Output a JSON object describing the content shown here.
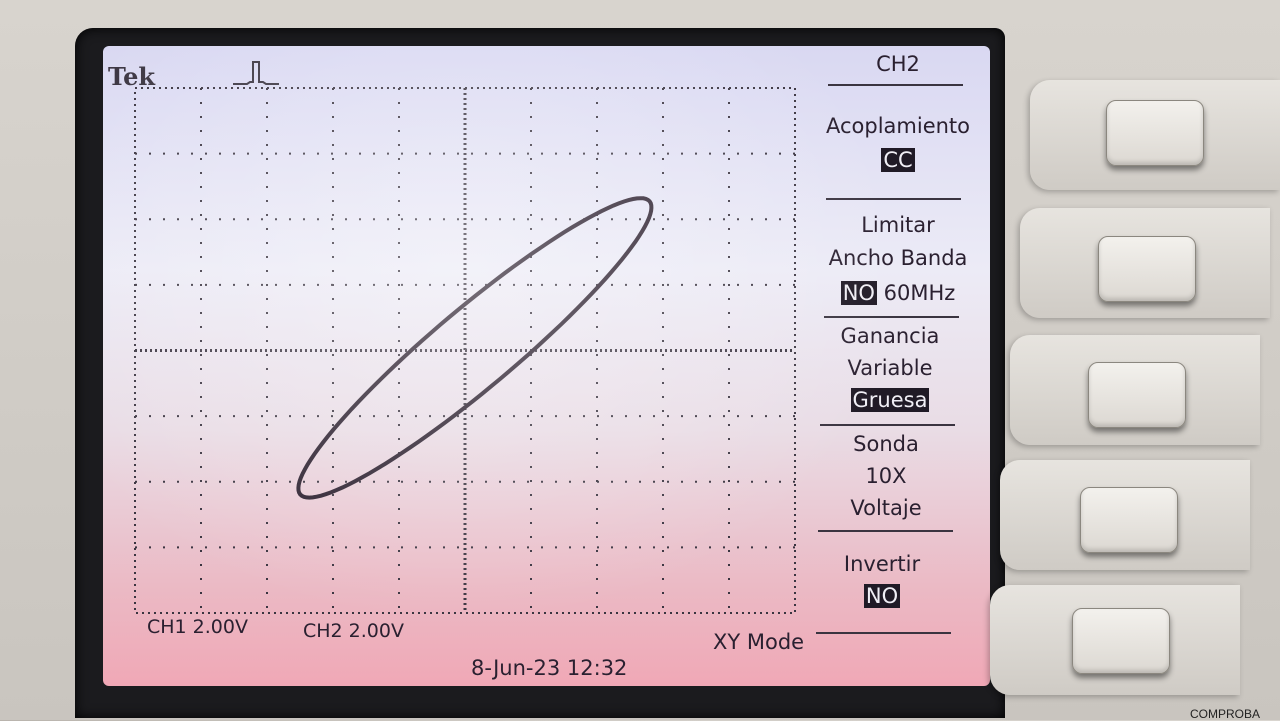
{
  "screen": {
    "brand": "Tek",
    "trigger_icon": "trigger-status-icon",
    "ch1_scale": "CH1  2.00V",
    "ch2_scale": "CH2  2.00V",
    "mode": "XY Mode",
    "datetime": "8-Jun-23 12:32"
  },
  "menu": {
    "title": "CH2",
    "coupling": {
      "label": "Acoplamiento",
      "value": "CC"
    },
    "bandwidth": {
      "line1": "Limitar",
      "line2": "Ancho Banda",
      "value": "NO",
      "option": "60MHz"
    },
    "gain": {
      "line1": "Ganancia",
      "line2": "Variable",
      "value": "Gruesa"
    },
    "probe": {
      "line1": "Sonda",
      "line2": "10X",
      "line3": "Voltaje"
    },
    "invert": {
      "label": "Invertir",
      "value": "NO"
    }
  },
  "device": {
    "corner_label": "COMPROBA"
  },
  "colors": {
    "trace": "#2b1f2e",
    "screen_text": "#2a2030",
    "highlight_bg": "#201a26"
  }
}
